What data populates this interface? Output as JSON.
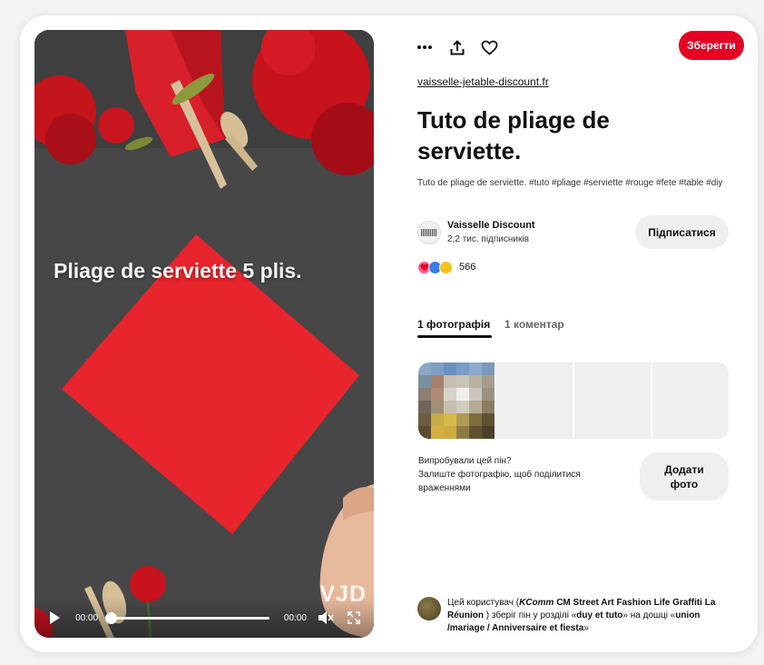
{
  "video": {
    "overlay_text": "Pliage de serviette 5 plis.",
    "watermark": "VJD",
    "current_time": "00:00",
    "duration": "00:00",
    "progress": 0.0
  },
  "toolbar": {
    "more_icon": "more-dots-icon",
    "share_icon": "share-icon",
    "like_icon": "heart-outline-icon",
    "save_label": "Зберегти",
    "accent": "#e60023"
  },
  "pin": {
    "source": "vaisselle-jetable-discount.fr",
    "title": "Tuto de pliage de serviette.",
    "description": "Tuto de pliage de serviette. #tuto #pliage #serviette #rouge #fete #table #diy"
  },
  "creator": {
    "name": "Vaisselle Discount",
    "followers": "2,2 тис. підписників",
    "follow_label": "Підписатися"
  },
  "reactions": {
    "count": "566"
  },
  "tabs": [
    {
      "label": "1 фотографія",
      "active": true
    },
    {
      "label": "1 коментар",
      "active": false
    }
  ],
  "try_pin": {
    "question": "Випробували цей пін?",
    "prompt": "Залиште фотографію, щоб поділитися враженнями",
    "add_photo_label_1": "Додати",
    "add_photo_label_2": "фото"
  },
  "saved_note": {
    "prefix": "Цей користувач (",
    "brand": "KComm",
    "user_rest": "CM Street Art Fashion Life Graffiti La Réunion",
    "middle": ") зберіг пін у розділі «",
    "section": "duy et tuto",
    "middle2": "» на дошці «",
    "board": "union /mariage / Anniversaire et fiesta",
    "suffix": "»"
  }
}
